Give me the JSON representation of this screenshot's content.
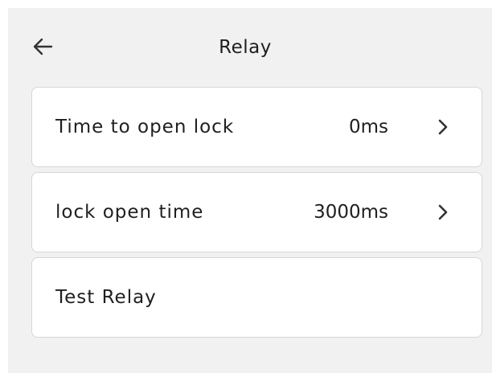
{
  "header": {
    "title": "Relay",
    "back_icon": "arrow-left-icon"
  },
  "settings": [
    {
      "label": "Time to open lock",
      "value": "0ms",
      "icon": "chevron-right-icon"
    },
    {
      "label": "lock open time",
      "value": "3000ms",
      "icon": "chevron-right-icon"
    },
    {
      "label": "Test Relay"
    }
  ],
  "colors": {
    "background": "#f1f1f1",
    "card": "#ffffff",
    "text": "#1f1f1f",
    "border": "#d6d6d6"
  }
}
